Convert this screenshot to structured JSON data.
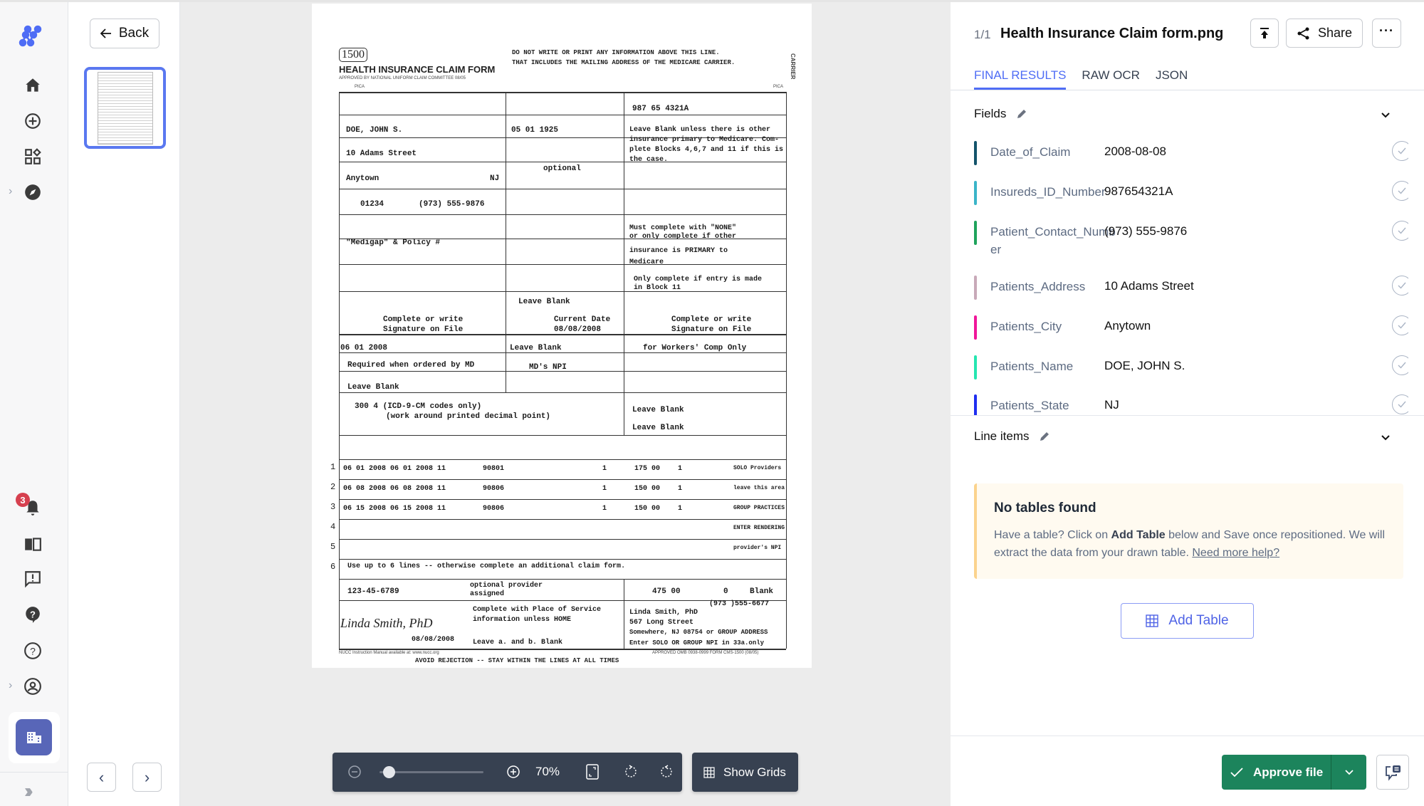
{
  "nav": {
    "logo": "nanonets-logo-icon",
    "items": [
      {
        "icon": "home-icon"
      },
      {
        "icon": "add-circle-icon"
      },
      {
        "icon": "apps-icon"
      },
      {
        "icon": "compass-icon"
      },
      {
        "icon": "bell-icon"
      },
      {
        "icon": "book-icon"
      },
      {
        "icon": "feedback-icon"
      },
      {
        "icon": "help-bubble-icon"
      },
      {
        "icon": "help-circle-icon"
      },
      {
        "icon": "account-icon"
      }
    ],
    "notification_count": "3",
    "org_icon": "building-icon",
    "collapse_icon": "double-chevron-right-icon"
  },
  "thumbnails": {
    "back_label": "Back",
    "prev_icon": "chevron-left-icon",
    "next_icon": "chevron-right-icon"
  },
  "viewer": {
    "zoom_label": "70%",
    "zoom_fraction": 0.05,
    "show_grids_label": "Show Grids",
    "document": {
      "form_number": "1500",
      "form_title": "HEALTH INSURANCE CLAIM FORM",
      "approved_by": "APPROVED BY NATIONAL UNIFORM CLAIM COMMITTEE 08/05",
      "header_notice_1": "DO NOT WRITE OR PRINT ANY INFORMATION ABOVE THIS LINE.",
      "header_notice_2": "THAT INCLUDES THE MAILING ADDRESS OF THE MEDICARE CARRIER.",
      "pica": "PICA",
      "carrier": "CARRIER",
      "insured_id": "987 65 4321A",
      "patient_name": "DOE, JOHN S.",
      "birth_date": "05  01  1925",
      "insured_name_note": "Leave Blank unless there is other",
      "insured_note_2": "insurance primary to Medicare. Com-",
      "insured_note_3": "plete Blocks 4,6,7 and 11 if this is",
      "insured_note_4": "the case.",
      "address": "10 Adams Street",
      "city": "Anytown",
      "state": "NJ",
      "zip": "01234",
      "phone": "(973) 555-9876",
      "optional": "optional",
      "policy_group": "Must complete with \"NONE\"",
      "policy_note_2": "or only complete if other",
      "policy_note_3": "insurance is PRIMARY to",
      "policy_note_4": "Medicare",
      "medigap": "\"Medigap\" & Policy #",
      "plan_note": "Only complete if entry is made",
      "plan_note_2": "in Block 11",
      "reserved_local": "Leave Blank",
      "signature_1": "Complete or write",
      "signature_2": "Signature on File",
      "current_date_label": "Current Date",
      "current_date": "08/08/2008",
      "date_current": "06  01  2008",
      "similar_illness": "Leave Blank",
      "workers_comp": "for Workers' Comp Only",
      "referring": "Required when ordered by MD",
      "md_npi": "MD's NPI",
      "local_use": "Leave Blank",
      "diagnosis": "300 4 (ICD-9-CM codes only)",
      "diagnosis_note": "(work around printed decimal point)",
      "resubmission": "Leave Blank",
      "prior_auth": "Leave Blank",
      "service_lines": [
        {
          "n": "1",
          "dates": "06 01 2008 06 01 2008 11",
          "cpt": "90801",
          "ptr": "1",
          "charge": "175 00",
          "units": "1",
          "provider": "SOLO Providers"
        },
        {
          "n": "2",
          "dates": "06 08 2008 06 08 2008 11",
          "cpt": "90806",
          "ptr": "1",
          "charge": "150 00",
          "units": "1",
          "provider": "leave this area"
        },
        {
          "n": "3",
          "dates": "06 15 2008 06 15 2008 11",
          "cpt": "90806",
          "ptr": "1",
          "charge": "150 00",
          "units": "1",
          "provider": "GROUP PRACTICES"
        },
        {
          "n": "4",
          "dates": "",
          "cpt": "",
          "ptr": "",
          "charge": "",
          "units": "",
          "provider": "ENTER RENDERING"
        },
        {
          "n": "5",
          "dates": "",
          "cpt": "",
          "ptr": "",
          "charge": "",
          "units": "",
          "provider": "provider's NPI"
        },
        {
          "n": "6",
          "dates": "",
          "cpt": "",
          "ptr": "",
          "charge": "",
          "units": "",
          "provider": ""
        }
      ],
      "line_note": "Use up to 6 lines -- otherwise complete an additional claim form.",
      "tax_id": "123-45-6789",
      "account_no": "optional provider assigned",
      "total_charge": "475 00",
      "amount_paid": "0",
      "balance_due": "Blank",
      "physician_signature": "Linda Smith, PhD",
      "physician_date": "08/08/2008",
      "facility": "Complete with Place of Service",
      "facility_2": "information unless HOME",
      "facility_3": "Leave a. and b. Blank",
      "billing_phone": "(973 )555-6677",
      "billing_1": "Linda Smith, PhD",
      "billing_2": "567 Long Street",
      "billing_3": "Somewhere, NJ 08754 or GROUP ADDRESS",
      "billing_4": "Enter SOLO OR GROUP NPI in 33a.only",
      "footer_left": "NUCC Instruction Manual available at: www.nucc.org",
      "footer_right": "APPROVED OMB 0938-0999 FORM CMS-1500 (08/05)",
      "footer_warning": "AVOID REJECTION -- STAY WITHIN THE LINES AT ALL TIMES"
    }
  },
  "panel": {
    "counter": "1/1",
    "file_title": "Health Insurance Claim form.png",
    "share_label": "Share",
    "tabs": [
      {
        "label": "FINAL RESULTS",
        "active": true
      },
      {
        "label": "RAW OCR",
        "active": false
      },
      {
        "label": "JSON",
        "active": false
      }
    ],
    "fields_title": "Fields",
    "fields": [
      {
        "key": "Date_of_Claim",
        "value": "2008-08-08",
        "color": "#14546b"
      },
      {
        "key": "Insureds_ID_Number",
        "value": "987654321A",
        "color": "#3ab4c8"
      },
      {
        "key": "Patient_Contact_Number",
        "value": "(973) 555-9876",
        "color": "#1fa35c"
      },
      {
        "key": "Patients_Address",
        "value": "10 Adams Street",
        "color": "#c8a9b8"
      },
      {
        "key": "Patients_City",
        "value": "Anytown",
        "color": "#f0169a"
      },
      {
        "key": "Patients_Name",
        "value": "DOE, JOHN S.",
        "color": "#25e6b0"
      },
      {
        "key": "Patients_State",
        "value": "NJ",
        "color": "#1f2ef0"
      }
    ],
    "line_items_title": "Line items",
    "notice": {
      "title": "No tables found",
      "text_1": "Have a table? Click on ",
      "text_bold": "Add Table",
      "text_2": " below and Save once repositioned. We will extract the data from your drawn table. ",
      "link": "Need more help?"
    },
    "add_table_label": "Add Table",
    "approve_label": "Approve file"
  }
}
